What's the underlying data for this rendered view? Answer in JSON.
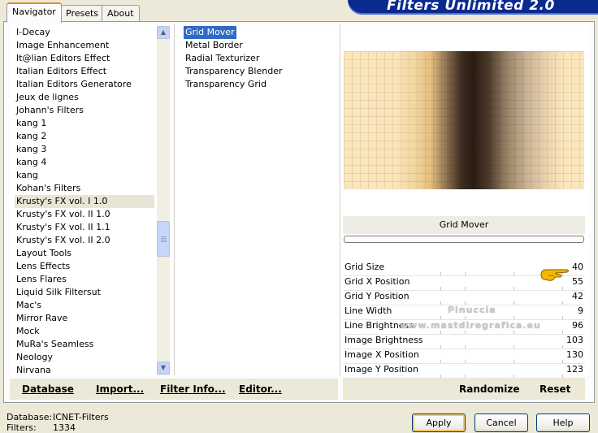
{
  "banner": {
    "title": "Filters Unlimited 2.0"
  },
  "tabs": [
    {
      "label": "Navigator",
      "active": true
    },
    {
      "label": "Presets",
      "active": false
    },
    {
      "label": "About",
      "active": false
    }
  ],
  "categories": [
    {
      "label": "I-Decay"
    },
    {
      "label": "Image Enhancement"
    },
    {
      "label": "It@lian Editors Effect"
    },
    {
      "label": "Italian Editors Effect"
    },
    {
      "label": "Italian Editors Generatore"
    },
    {
      "label": "Jeux de lignes"
    },
    {
      "label": "Johann's Filters"
    },
    {
      "label": "kang 1"
    },
    {
      "label": "kang 2"
    },
    {
      "label": "kang 3"
    },
    {
      "label": "kang 4"
    },
    {
      "label": "kang"
    },
    {
      "label": "Kohan's Filters"
    },
    {
      "label": "Krusty's FX vol. I 1.0"
    },
    {
      "label": "Krusty's FX vol. II 1.0"
    },
    {
      "label": "Krusty's FX vol. II 1.1"
    },
    {
      "label": "Krusty's FX vol. II 2.0"
    },
    {
      "label": "Layout Tools"
    },
    {
      "label": "Lens Effects"
    },
    {
      "label": "Lens Flares"
    },
    {
      "label": "Liquid Silk Filtersut"
    },
    {
      "label": "Mac's"
    },
    {
      "label": "Mirror Rave"
    },
    {
      "label": "Mock"
    },
    {
      "label": "MuRa's Seamless"
    },
    {
      "label": "Neology"
    },
    {
      "label": "Nirvana"
    }
  ],
  "highlighted_category_index": 13,
  "filters": [
    {
      "label": "Grid Mover"
    },
    {
      "label": "Metal Border"
    },
    {
      "label": "Radial Texturizer"
    },
    {
      "label": "Transparency Blender"
    },
    {
      "label": "Transparency Grid"
    }
  ],
  "selected_filter_index": 0,
  "filter_title": "Grid Mover",
  "params": [
    {
      "label": "Grid Size",
      "value": "40"
    },
    {
      "label": "Grid X Position",
      "value": "55"
    },
    {
      "label": "Grid Y Position",
      "value": "42"
    },
    {
      "label": "Line Width",
      "value": "9"
    },
    {
      "label": "Line Brightness",
      "value": "96"
    },
    {
      "label": "Image Brightness",
      "value": "103"
    },
    {
      "label": "Image X Position",
      "value": "130"
    },
    {
      "label": "Image Y Position",
      "value": "123"
    }
  ],
  "watermark": {
    "line1": "Pinuccia",
    "line2": "www.mastdiregrafica.eu"
  },
  "left_toolbar": {
    "database": "Database",
    "import": "Import...",
    "filter_info": "Filter Info...",
    "editor": "Editor..."
  },
  "right_toolbar": {
    "randomize": "Randomize",
    "reset": "Reset"
  },
  "status": {
    "database_label": "Database:",
    "database_value": "ICNET-Filters",
    "filters_label": "Filters:",
    "filters_value": "1334"
  },
  "dialog_buttons": {
    "apply": "Apply",
    "cancel": "Cancel",
    "help": "Help"
  },
  "colors": {
    "banner": "#0b2a8f",
    "selection": "#316ac5",
    "tab_accent": "#e68b2c"
  }
}
